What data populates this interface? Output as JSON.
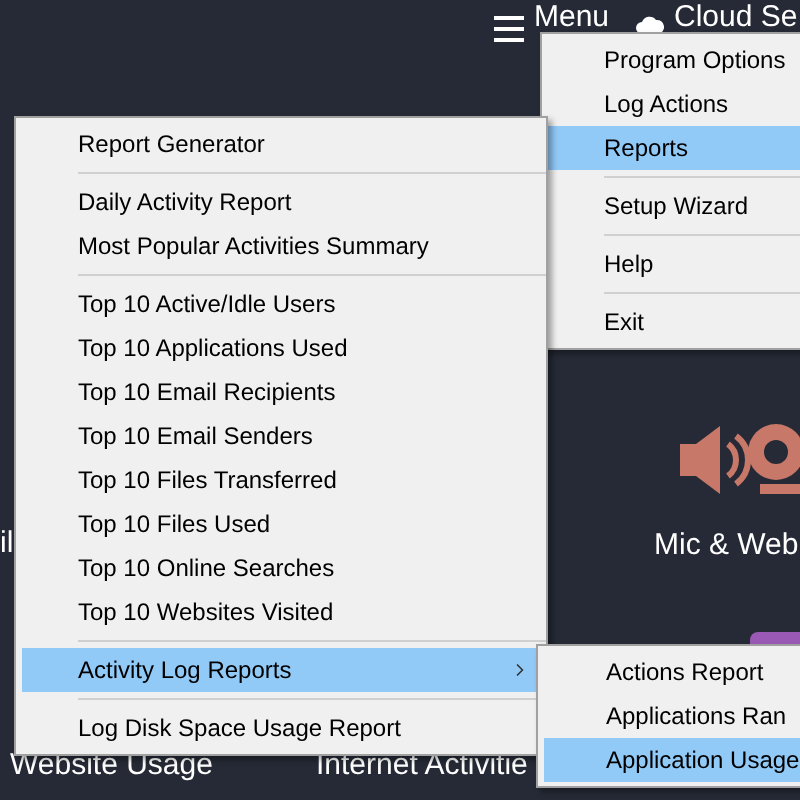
{
  "background": {
    "menu_label": "Menu",
    "cloud_label": "Cloud Se",
    "left_fragment_middle": "il",
    "mic_label": "Mic & Web",
    "website_label": "Website Usage",
    "internet_label": "Internet Activitie"
  },
  "main_menu": [
    {
      "kind": "item",
      "label": "Program Options",
      "selected": false
    },
    {
      "kind": "item",
      "label": "Log Actions",
      "selected": false
    },
    {
      "kind": "item",
      "label": "Reports",
      "selected": true
    },
    {
      "kind": "separator"
    },
    {
      "kind": "item",
      "label": "Setup Wizard",
      "selected": false
    },
    {
      "kind": "separator"
    },
    {
      "kind": "item",
      "label": "Help",
      "selected": false
    },
    {
      "kind": "separator"
    },
    {
      "kind": "item",
      "label": "Exit",
      "selected": false
    }
  ],
  "reports_menu": [
    {
      "kind": "item",
      "label": "Report Generator",
      "selected": false
    },
    {
      "kind": "separator"
    },
    {
      "kind": "item",
      "label": "Daily Activity Report",
      "selected": false
    },
    {
      "kind": "item",
      "label": "Most Popular Activities Summary",
      "selected": false
    },
    {
      "kind": "separator"
    },
    {
      "kind": "item",
      "label": "Top 10 Active/Idle Users",
      "selected": false
    },
    {
      "kind": "item",
      "label": "Top 10 Applications Used",
      "selected": false
    },
    {
      "kind": "item",
      "label": "Top 10 Email Recipients",
      "selected": false
    },
    {
      "kind": "item",
      "label": "Top 10 Email Senders",
      "selected": false
    },
    {
      "kind": "item",
      "label": "Top 10 Files Transferred",
      "selected": false
    },
    {
      "kind": "item",
      "label": "Top 10 Files Used",
      "selected": false
    },
    {
      "kind": "item",
      "label": "Top 10 Online Searches",
      "selected": false
    },
    {
      "kind": "item",
      "label": "Top 10 Websites Visited",
      "selected": false
    },
    {
      "kind": "separator"
    },
    {
      "kind": "item",
      "label": "Activity Log Reports",
      "selected": true,
      "submenu": true
    },
    {
      "kind": "separator"
    },
    {
      "kind": "item",
      "label": "Log Disk Space Usage Report",
      "selected": false
    }
  ],
  "activity_log_menu": [
    {
      "kind": "item",
      "label": "Actions Report",
      "selected": false
    },
    {
      "kind": "item",
      "label": "Applications Ran",
      "selected": false
    },
    {
      "kind": "item",
      "label": "Application Usage",
      "selected": true
    }
  ]
}
